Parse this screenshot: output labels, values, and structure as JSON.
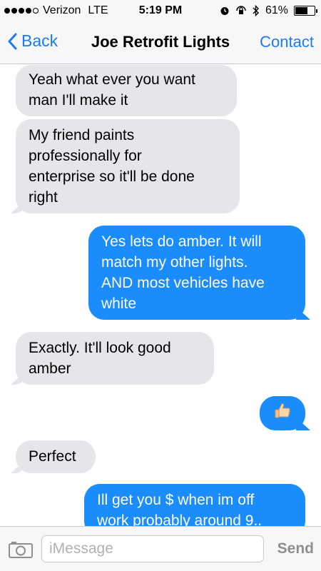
{
  "status_bar": {
    "carrier": "Verizon",
    "network": "LTE",
    "time": "5:19 PM",
    "battery": "61%",
    "icons": [
      "signal-dots-icon",
      "alarm-icon",
      "lock-rotation-icon",
      "bluetooth-icon",
      "battery-icon"
    ]
  },
  "nav": {
    "back_label": "Back",
    "title": "Joe Retrofit Lights",
    "contact_label": "Contact"
  },
  "messages": [
    {
      "direction": "in",
      "lines": [
        "Yeah what ever you want",
        "man I'll make it"
      ]
    },
    {
      "direction": "in",
      "lines": [
        "My friend paints",
        "professionally for",
        "enterprise so it'll be done",
        "right"
      ]
    },
    {
      "direction": "out",
      "lines": [
        "Yes lets do amber. It will",
        "match my other lights.",
        "AND most vehicles have",
        "white"
      ]
    },
    {
      "direction": "in",
      "lines": [
        "Exactly. It'll look good",
        "amber"
      ]
    },
    {
      "direction": "out",
      "emoji": "👍",
      "icon": "thumbs-up-icon"
    },
    {
      "direction": "in",
      "lines": [
        "Perfect"
      ]
    },
    {
      "direction": "out",
      "lines": [
        "Ill get you $ when im off",
        "work probably around 9.."
      ]
    }
  ],
  "input": {
    "placeholder": "iMessage",
    "value": "",
    "send_label": "Send"
  },
  "colors": {
    "accent": "#1a7cf5",
    "outgoing_bubble": "#1a8cfb",
    "incoming_bubble": "#e5e5ea",
    "send_disabled": "#8e8e93"
  }
}
